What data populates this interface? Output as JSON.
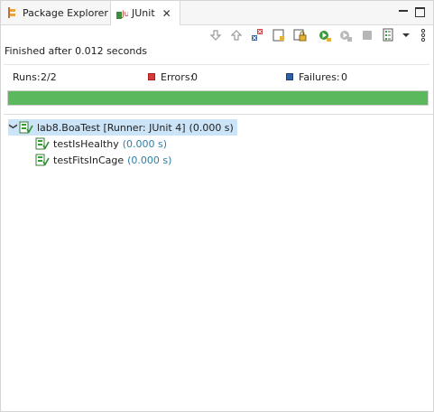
{
  "tabs": [
    {
      "label": "Package Explorer",
      "active": false
    },
    {
      "label": "JUnit",
      "active": true
    }
  ],
  "status": "Finished after 0.012 seconds",
  "counters": {
    "runs_label": "Runs:",
    "runs_value": "2/2",
    "errors_label": "Errors:",
    "errors_value": "0",
    "failures_label": "Failures:",
    "failures_value": "0"
  },
  "progress": {
    "fraction": 1.0,
    "color": "#5cb85c"
  },
  "tree": {
    "root": {
      "label": "lab8.BoaTest [Runner: JUnit 4]",
      "time": "(0.000 s)"
    },
    "children": [
      {
        "label": "testIsHealthy",
        "time": "(0.000 s)"
      },
      {
        "label": "testFitsInCage",
        "time": "(0.000 s)"
      }
    ]
  },
  "colors": {
    "accent_selection": "#cce4f7",
    "time_text": "#2c7fa8",
    "error_red": "#d83b3b",
    "failure_blue": "#2f5fa7"
  },
  "icons": {
    "toolbar": [
      "next-failure-icon",
      "previous-failure-icon",
      "show-failures-only-icon",
      "scroll-lock-icon",
      "lock-icon",
      "rerun-icon",
      "rerun-failed-first-icon",
      "stop-icon",
      "history-icon",
      "dropdown-icon",
      "view-menu-icon"
    ]
  }
}
